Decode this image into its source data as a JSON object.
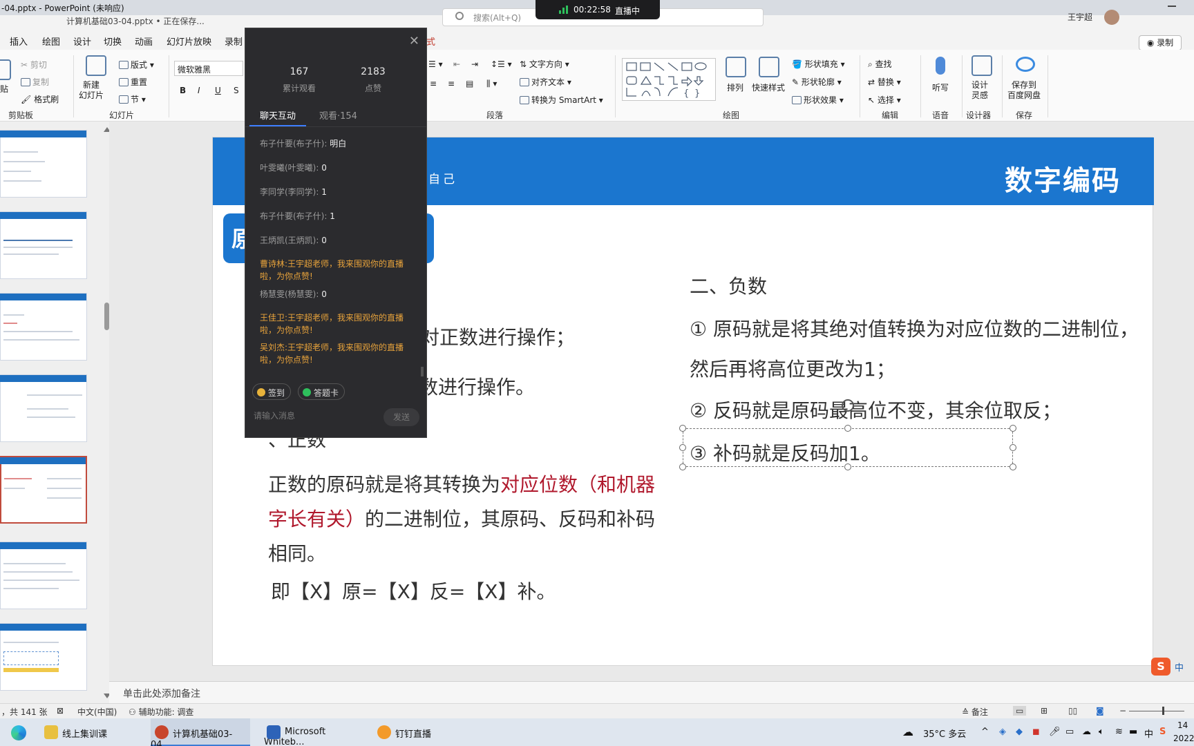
{
  "window": {
    "title": "-04.pptx - PowerPoint (未响应)",
    "doc_status": "计算机基础03-04.pptx • 正在保存...",
    "search_placeholder": "搜索(Alt+Q)",
    "user_name": "王宇超"
  },
  "live_pill": {
    "time": "00:22:58",
    "status": "直播中"
  },
  "menu": [
    "插入",
    "绘图",
    "设计",
    "切换",
    "动画",
    "幻灯片放映",
    "录制",
    "式"
  ],
  "record_button": "录制",
  "ribbon": {
    "clipboard": {
      "paste": "贴",
      "cut": "剪切",
      "copy": "复制",
      "format_painter": "格式刷",
      "label": "剪贴板"
    },
    "slides": {
      "new_slide": "新建\n幻灯片",
      "layout": "版式",
      "reset": "重置",
      "section": "节",
      "label": "幻灯片"
    },
    "font": {
      "font_name": "微软雅黑",
      "bold": "B",
      "italic": "I",
      "underline": "U",
      "strike": "S"
    },
    "paragraph": {
      "text_direction": "文字方向",
      "align_text": "对齐文本",
      "smartart": "转换为 SmartArt",
      "label": "段落"
    },
    "drawing": {
      "arrange": "排列",
      "quick_styles": "快速样式",
      "shape_fill": "形状填充",
      "shape_outline": "形状轮廓",
      "shape_effects": "形状效果",
      "label": "绘图"
    },
    "editing": {
      "find": "查找",
      "replace": "替换",
      "select": "选择",
      "label": "编辑"
    },
    "voice": {
      "dictate": "听写",
      "label": "语音"
    },
    "designer": {
      "design_ideas": "设计\n灵感",
      "label": "设计器"
    },
    "save": {
      "save_baidu": "保存到\n百度网盘",
      "label": "保存"
    }
  },
  "slide": {
    "header_title": "数字编码",
    "header_subtitle": "自己",
    "tab_char": "原",
    "left_line1": "对正数进行操作；",
    "left_line2": "数进行操作。",
    "left_heading": "、正数",
    "para_a": "正数的原码就是将其转换为",
    "para_red1": "对应位数（和机器",
    "para_red2": "字长有关）",
    "para_b": "的二进制位，其原码、反码和补码",
    "para_c": "相同。",
    "formula": "即【X】原=【X】反=【X】补。",
    "right_heading": "二、负数",
    "right_1a": "① 原码就是将其绝对值转换为对应位数的二进制位，",
    "right_1b": "然后再将高位更改为1；",
    "right_2": "② 反码就是原码最高位不变，其余位取反；",
    "right_3": "③ 补码就是反码加1。"
  },
  "notes_placeholder": "单击此处添加备注",
  "status": {
    "slide_count": "，共 141 张",
    "language": "中文(中国)",
    "accessibility": "辅助功能: 调查",
    "notes": "备注"
  },
  "chat": {
    "total_views": "167",
    "total_views_label": "累计观看",
    "likes": "2183",
    "likes_label": "点赞",
    "tab_chat": "聊天互动",
    "tab_viewers": "观看·154",
    "messages": [
      {
        "name": "布子什要(布子什):",
        "text": "明白",
        "gift": false
      },
      {
        "name": "叶雯曦(叶雯曦):",
        "text": "0",
        "gift": false
      },
      {
        "name": "李同学(李同学):",
        "text": "1",
        "gift": false
      },
      {
        "name": "布子什要(布子什):",
        "text": "1",
        "gift": false
      },
      {
        "name": "王炳凯(王炳凯):",
        "text": "0",
        "gift": false
      },
      {
        "name": "曹诗林:",
        "text": "王宇超老师，我来围观你的直播啦，为你点赞!",
        "gift": true
      },
      {
        "name": "杨慧雯(杨慧雯):",
        "text": "0",
        "gift": false
      },
      {
        "name": "王佳卫:",
        "text": "王宇超老师，我来围观你的直播啦，为你点赞!",
        "gift": true
      },
      {
        "name": "吴刘杰:",
        "text": "王宇超老师，我来围观你的直播啦，为你点赞!",
        "gift": true
      }
    ],
    "sign_in": "签到",
    "answer_card": "答题卡",
    "input_placeholder": "请输入消息",
    "send": "发送"
  },
  "taskbar": {
    "items": [
      "线上集训课",
      "计算机基础03-04....",
      "Microsoft Whiteb...",
      "钉钉直播"
    ],
    "weather": "35°C  多云",
    "ime": "中",
    "clock_time": "14",
    "clock_date": "2022"
  },
  "colors": {
    "brand_blue": "#1b76cf",
    "accent_red": "#b0182c",
    "chat_bg": "#2b2b2e",
    "gift_orange": "#e8a33b"
  }
}
